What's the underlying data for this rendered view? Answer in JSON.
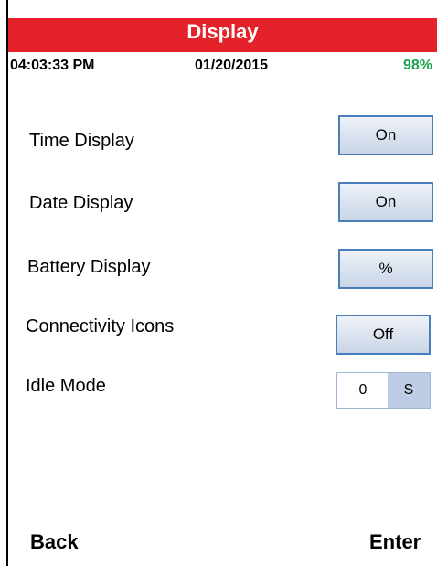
{
  "header": {
    "title": "Display"
  },
  "status_bar": {
    "time": "04:03:33 PM",
    "date": "01/20/2015",
    "battery": "98%",
    "battery_color": "#1aa34a"
  },
  "settings": {
    "time_display": {
      "label": "Time Display",
      "value": "On"
    },
    "date_display": {
      "label": "Date Display",
      "value": "On"
    },
    "battery_display": {
      "label": "Battery Display",
      "value": "%"
    },
    "connectivity_icons": {
      "label": "Connectivity Icons",
      "value": "Off"
    },
    "idle_mode": {
      "label": "Idle Mode",
      "value": "0",
      "unit": "S"
    }
  },
  "softkeys": {
    "back": "Back",
    "enter": "Enter"
  },
  "colors": {
    "title_bar": "#e52129",
    "button_border": "#4a7ebb"
  }
}
